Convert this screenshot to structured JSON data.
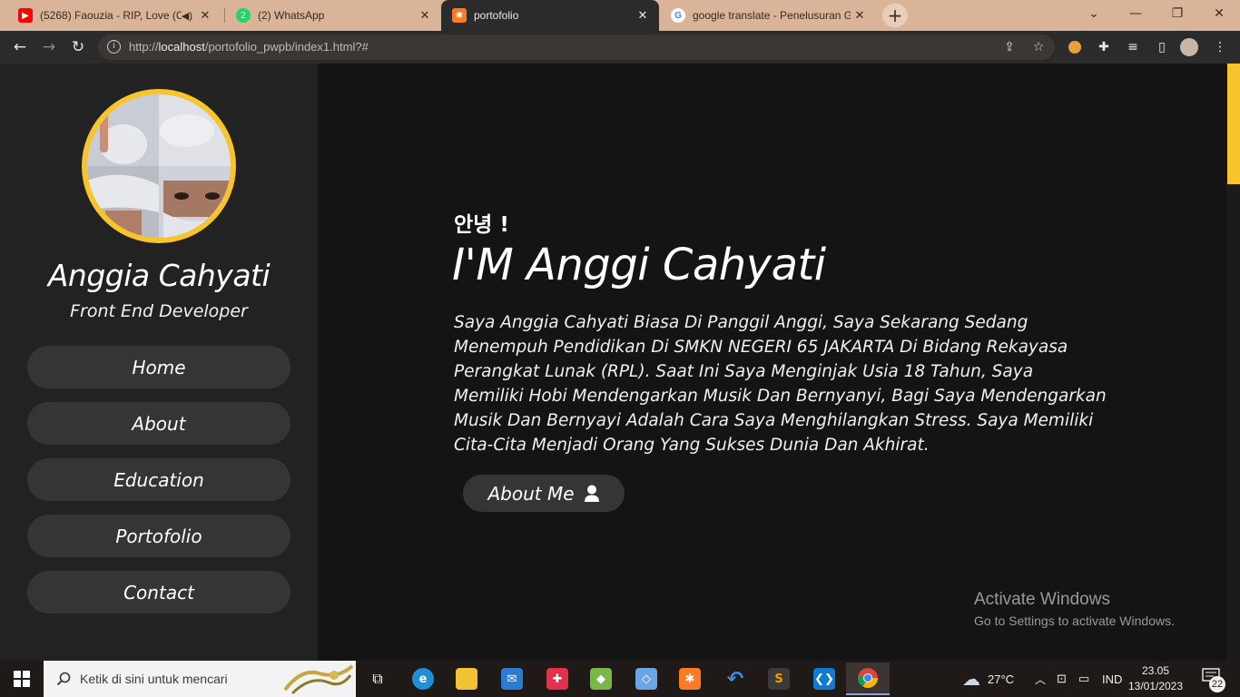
{
  "browser": {
    "tabs": [
      {
        "title": "(5268) Faouzia - RIP, Love (C",
        "favicon": "youtube-icon",
        "active": false
      },
      {
        "title": "(2) WhatsApp",
        "favicon": "whatsapp-icon",
        "active": false
      },
      {
        "title": "portofolio",
        "favicon": "xampp-icon",
        "active": true
      },
      {
        "title": "google translate - Penelusuran G",
        "favicon": "google-icon",
        "active": false
      }
    ],
    "url_prefix": "http://",
    "url_host": "localhost",
    "url_path": "/portofolio_pwpb/index1.html?#"
  },
  "sidebar": {
    "name": "Anggia Cahyati",
    "role": "Front End Developer",
    "nav": [
      {
        "label": "Home"
      },
      {
        "label": "About"
      },
      {
        "label": "Education"
      },
      {
        "label": "Portofolio"
      },
      {
        "label": "Contact"
      }
    ]
  },
  "hero": {
    "greeting": "안녕 !",
    "headline": "I'M Anggi Cahyati",
    "bio": "Saya Anggia Cahyati Biasa Di Panggil Anggi, Saya Sekarang Sedang Menempuh Pendidikan Di SMKN NEGERI 65 JAKARTA Di Bidang Rekayasa Perangkat Lunak (RPL). Saat Ini Saya Menginjak Usia 18 Tahun, Saya Memiliki Hobi Mendengarkan Musik Dan Bernyanyi, Bagi Saya Mendengarkan Musik Dan Bernyayi Adalah Cara Saya Menghilangkan Stress. Saya Memiliki Cita-Cita Menjadi Orang Yang Sukses Dunia Dan Akhirat.",
    "cta_label": "About Me"
  },
  "watermark": {
    "line1": "Activate Windows",
    "line2": "Go to Settings to activate Windows."
  },
  "taskbar": {
    "search_placeholder": "Ketik di sini untuk mencari",
    "weather": "27°C",
    "language": "IND",
    "time": "23.05",
    "date": "13/01/2023",
    "notifications": "22"
  },
  "colors": {
    "accent": "#f7c52b",
    "sidebar_bg": "#222222",
    "page_bg": "#141414",
    "button_bg": "#353535"
  }
}
